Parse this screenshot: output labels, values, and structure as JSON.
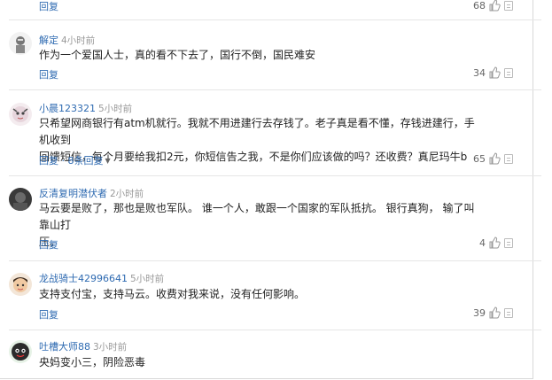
{
  "top": {
    "reply_label": "回复",
    "likes": "68"
  },
  "comments": [
    {
      "username": "解定",
      "time": "4小时前",
      "text": "作为一个爱国人士，真的看不下去了，国行不倒，国民难安",
      "reply_label": "回复",
      "likes": "34"
    },
    {
      "username": "小晨123321",
      "time": "5小时前",
      "text_lines": [
        "只希望网商银行有atm机就行。我就不用进建行去存钱了。老子真是看不懂，存钱进建行，手机收到",
        "回馈短信，每个月要给我扣2元，你短信告之我，不是你们应该做的吗？还收费？真尼玛牛b"
      ],
      "reply_label": "回复",
      "replies_label": "8条回复",
      "likes": "65"
    },
    {
      "username": "反清复明潜伏者",
      "time": "2小时前",
      "text_lines": [
        "马云要是败了，那也是败也军队。 谁一个人，敢跟一个国家的军队抵抗。 银行真狗， 输了叫靠山打",
        "压。"
      ],
      "reply_label": "回复",
      "likes": "4"
    },
    {
      "username": "龙战骑士42996641",
      "time": "5小时前",
      "text": "支持支付宝，支持马云。收费对我来说，没有任何影响。",
      "reply_label": "回复",
      "likes": "39"
    },
    {
      "username": "吐槽大师88",
      "time": "3小时前",
      "text": "央妈变小三，阴险恶毒"
    }
  ],
  "colors": {
    "username": "#2e6ab1",
    "time": "#999999",
    "divider": "#e6e6e6"
  }
}
